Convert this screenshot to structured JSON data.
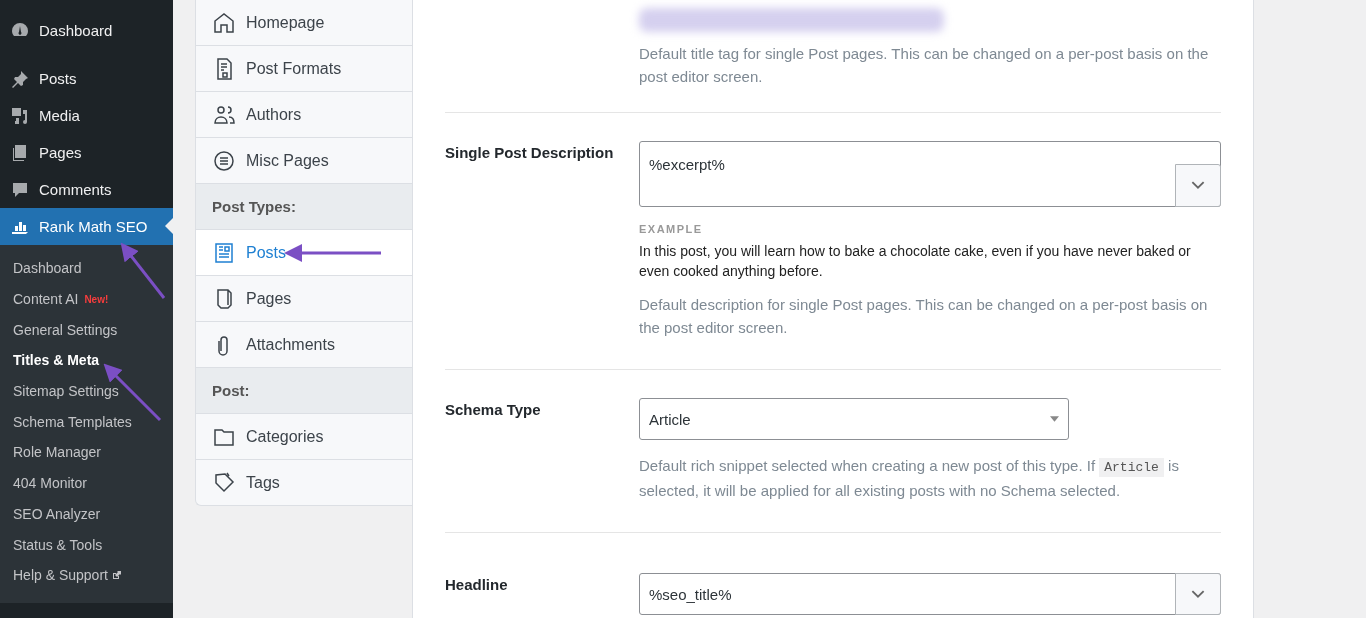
{
  "admin_menu": {
    "items": [
      {
        "label": "Dashboard",
        "selected": false
      },
      {
        "label": "Posts",
        "selected": false
      },
      {
        "label": "Media",
        "selected": false
      },
      {
        "label": "Pages",
        "selected": false
      },
      {
        "label": "Comments",
        "selected": false
      },
      {
        "label": "Rank Math SEO",
        "selected": true
      }
    ],
    "submenu": [
      {
        "label": "Dashboard",
        "selected": false
      },
      {
        "label": "Content AI",
        "badge": "New!",
        "selected": false
      },
      {
        "label": "General Settings",
        "selected": false
      },
      {
        "label": "Titles & Meta",
        "selected": true
      },
      {
        "label": "Sitemap Settings",
        "selected": false
      },
      {
        "label": "Schema Templates",
        "selected": false
      },
      {
        "label": "Role Manager",
        "selected": false
      },
      {
        "label": "404 Monitor",
        "selected": false
      },
      {
        "label": "SEO Analyzer",
        "selected": false
      },
      {
        "label": "Status & Tools",
        "selected": false
      },
      {
        "label": "Help & Support",
        "external": true,
        "selected": false
      }
    ]
  },
  "settings_nav": [
    {
      "kind": "item",
      "label": "Homepage",
      "selected": false
    },
    {
      "kind": "item",
      "label": "Post Formats",
      "selected": false
    },
    {
      "kind": "item",
      "label": "Authors",
      "selected": false
    },
    {
      "kind": "item",
      "label": "Misc Pages",
      "selected": false
    },
    {
      "kind": "heading",
      "label": "Post Types:"
    },
    {
      "kind": "item",
      "label": "Posts",
      "selected": true
    },
    {
      "kind": "item",
      "label": "Pages",
      "selected": false
    },
    {
      "kind": "item",
      "label": "Attachments",
      "selected": false
    },
    {
      "kind": "heading",
      "label": "Post:"
    },
    {
      "kind": "item",
      "label": "Categories",
      "selected": false
    },
    {
      "kind": "item",
      "label": "Tags",
      "selected": false
    }
  ],
  "title_field": {
    "description": "Default title tag for single Post pages. This can be changed on a per-post basis on the post editor screen."
  },
  "fields": [
    {
      "kind": "template",
      "label": "Single Post Description",
      "value": "%excerpt%",
      "multiline": true,
      "example_label": "EXAMPLE",
      "example": "In this post, you will learn how to bake a chocolate cake, even if you have never baked or even cooked anything before.",
      "description": [
        "Default description for single Post pages. This can be changed on a per-post basis on the post editor screen."
      ]
    },
    {
      "kind": "select",
      "label": "Schema Type",
      "value": "Article",
      "description": [
        "Default rich snippet selected when creating a new post of this type. If ",
        "Article",
        " is selected, it will be applied for all existing posts with no Schema selected."
      ]
    },
    {
      "kind": "template",
      "label": "Headline",
      "value": "%seo_title%",
      "multiline": false
    }
  ]
}
